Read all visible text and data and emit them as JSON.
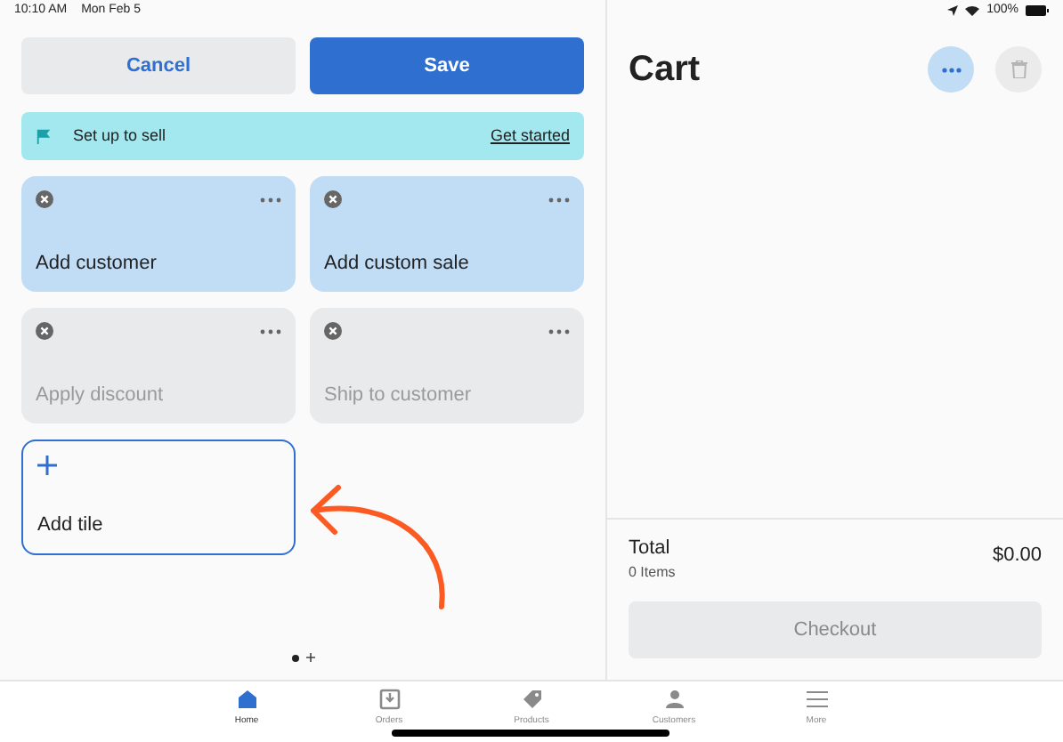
{
  "status_bar": {
    "time": "10:10 AM",
    "date": "Mon Feb 5",
    "battery": "100%"
  },
  "actions": [
    {
      "label": "Cancel",
      "kind": "secondary"
    },
    {
      "label": "Save",
      "kind": "primary"
    }
  ],
  "banner": {
    "text": "Set up to sell",
    "link": "Get started"
  },
  "tiles": [
    {
      "label": "Add customer",
      "disabled": false
    },
    {
      "label": "Add custom sale",
      "disabled": false
    },
    {
      "label": "Apply discount",
      "disabled": true
    },
    {
      "label": "Ship to customer",
      "disabled": true
    }
  ],
  "add_tile": {
    "label": "Add tile"
  },
  "pages": [
    {
      "selected": true
    }
  ],
  "cart": {
    "title": "Cart",
    "total_label": "Total",
    "items": "0 Items",
    "total": "$0.00",
    "checkout": "Checkout",
    "checkout_disabled": true
  },
  "tab_bar": [
    {
      "label": "Home",
      "kind": "home",
      "selected": true
    },
    {
      "label": "Orders",
      "kind": "orders",
      "selected": false
    },
    {
      "label": "Products",
      "kind": "tag",
      "selected": false
    },
    {
      "label": "Customers",
      "kind": "person",
      "selected": false
    },
    {
      "label": "More",
      "kind": "menu",
      "selected": false
    }
  ]
}
